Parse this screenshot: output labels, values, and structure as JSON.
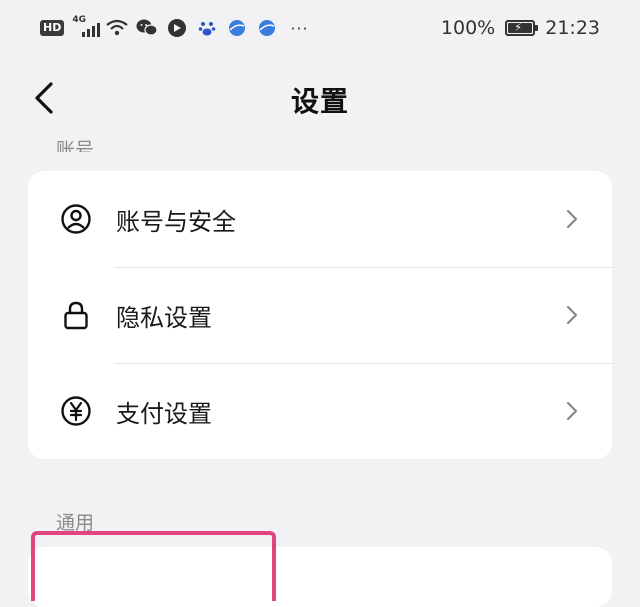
{
  "status_bar": {
    "hd_label": "HD",
    "network_label": "4G",
    "battery_percent": "100%",
    "time": "21:23",
    "icons": [
      "wifi-icon",
      "wechat-icon",
      "message-icon",
      "baidu-paw-icon",
      "browser-icon",
      "browser-icon",
      "more-icon"
    ]
  },
  "nav": {
    "title": "设置"
  },
  "sections": {
    "account_label": "账号",
    "general_label": "通用"
  },
  "account_items": [
    {
      "label": "账号与安全",
      "icon": "user-circle-icon"
    },
    {
      "label": "隐私设置",
      "icon": "lock-icon"
    },
    {
      "label": "支付设置",
      "icon": "yen-circle-icon"
    }
  ],
  "colors": {
    "background": "#f2f2f5",
    "card": "#ffffff",
    "highlight_border": "#e0457f",
    "section_label": "#8a8a8a"
  }
}
